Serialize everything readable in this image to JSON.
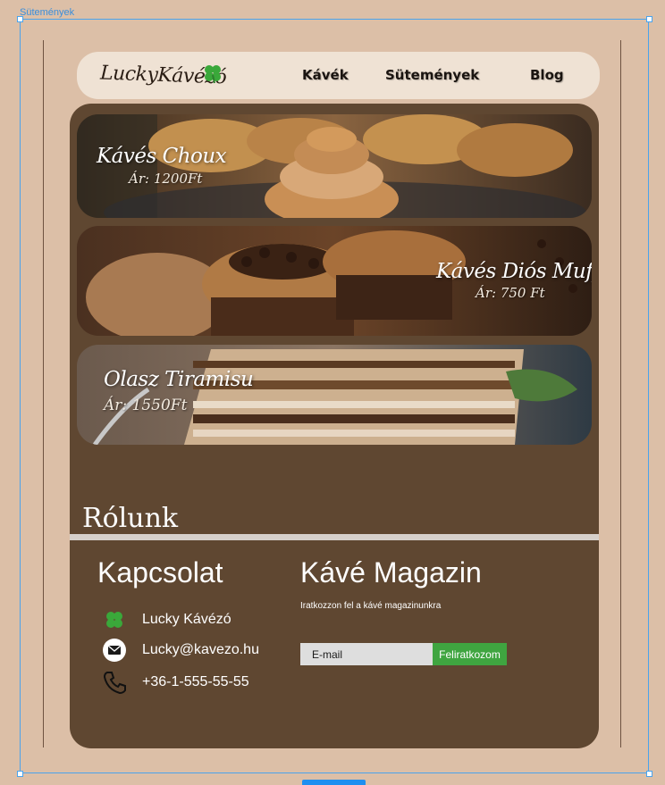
{
  "editor": {
    "frame_label": "Sütemények"
  },
  "header": {
    "logo_text": "LuckyKávézó",
    "nav": [
      {
        "label": "Kávék"
      },
      {
        "label": "Sütemények"
      },
      {
        "label": "Blog"
      }
    ]
  },
  "products": [
    {
      "name": "Kávés Choux",
      "price": "Ár: 1200Ft"
    },
    {
      "name": "Kávés Diós Muffin",
      "price": "Ár: 750 Ft"
    },
    {
      "name": "Olasz Tiramisu",
      "price": "Ár: 1550Ft"
    }
  ],
  "about": {
    "title": "Rólunk"
  },
  "contact": {
    "title": "Kapcsolat",
    "items": [
      {
        "icon": "clover-icon",
        "text": "Lucky Kávézó"
      },
      {
        "icon": "envelope-icon",
        "text": "Lucky@kavezo.hu"
      },
      {
        "icon": "phone-icon",
        "text": "+36-1-555-55-55"
      }
    ]
  },
  "magazine": {
    "title": "Kávé Magazin",
    "subtitle": "Iratkozzon fel a kávé magazinunkra",
    "email_placeholder": "E-mail",
    "subscribe_label": "Feliratkozom"
  },
  "colors": {
    "page_bg": "#dcbfa7",
    "panel_bg": "#5f4731",
    "navbar_bg": "#efe2d4",
    "accent_green": "#3fa540",
    "selection_blue": "#4aa3ec"
  }
}
